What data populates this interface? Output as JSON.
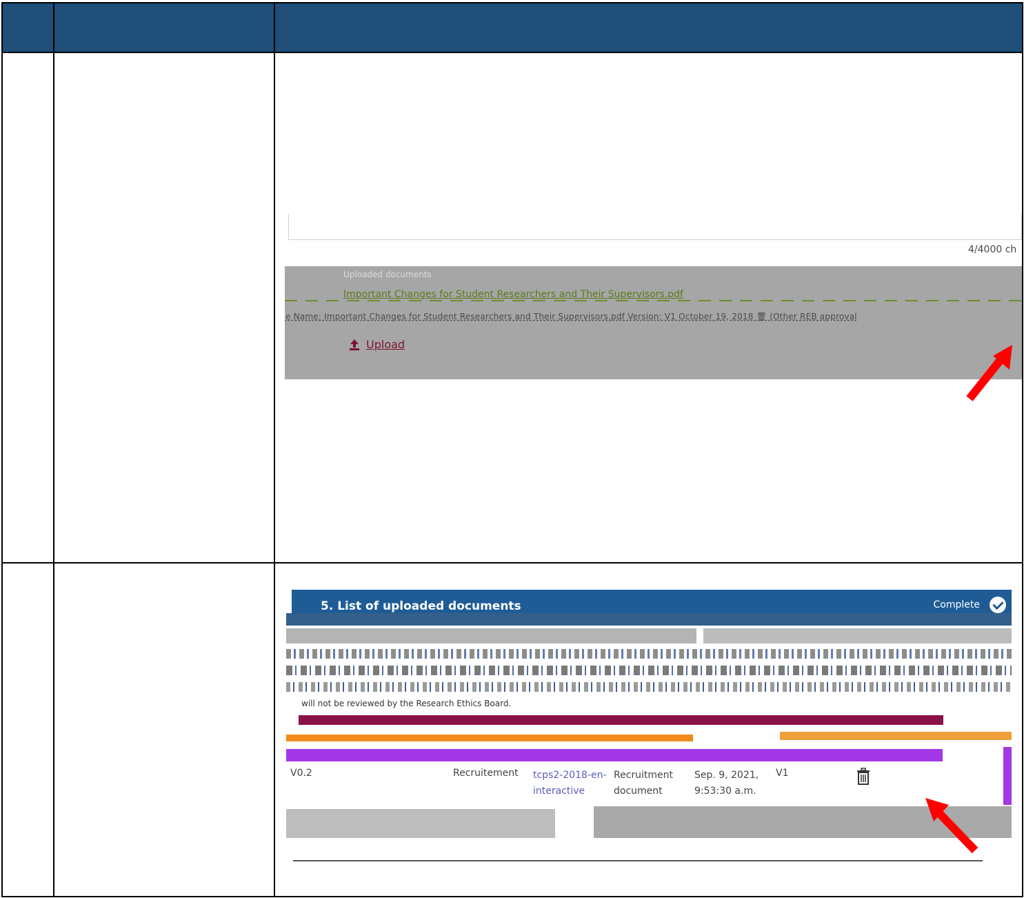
{
  "table": {
    "header_color": "#1f4e79",
    "header_cells": [
      "",
      "",
      ""
    ],
    "rows": [
      {
        "number": "",
        "step": ""
      },
      {
        "number": "",
        "step": ""
      }
    ]
  },
  "screenshot_1": {
    "char_counter": "4/4000 ch",
    "docs_label": "Uploaded documents",
    "file_link": "Important Changes for Student Researchers and Their Supervisors.pdf",
    "meta_line": "ile Name: Important Changes for Student Researchers and Their Supervisors.pdf Version: V1 October 19, 2018 🗑 (Other REB approval",
    "upload_label": "Upload",
    "upload_icon": "upload-icon",
    "arrow_color": "#ff0000"
  },
  "screenshot_2": {
    "title": "5. List of uploaded documents",
    "status": "Complete",
    "status_icon": "check-circle-icon",
    "info_text": "will not be reviewed by the Research Ethics Board.",
    "row": {
      "version": "V0.2",
      "type": "Recruitement",
      "file": "tcps2-2018-en-interactive",
      "category": "Recruitment document",
      "date": "Sep. 9, 2021, 9:53:30 a.m.",
      "doc_version": "V1",
      "delete_icon": "trash-icon"
    },
    "arrow_color": "#ff0000"
  }
}
